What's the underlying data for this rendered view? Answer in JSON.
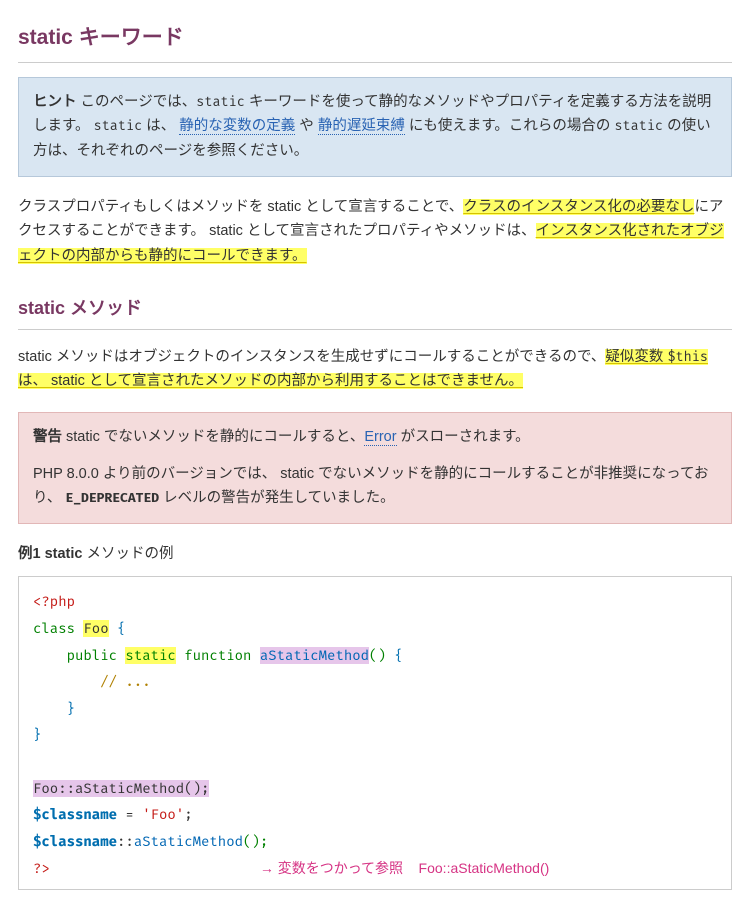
{
  "h2": "static キーワード",
  "tip": {
    "lead": "ヒント",
    "t1": " このページでは、",
    "kw1": "static",
    "t2": " キーワードを使って静的なメソッドやプロパティを定義する方法を説明します。 ",
    "kw2": "static",
    "t3": " は、 ",
    "link1": "静的な変数の定義",
    "t4": " や ",
    "link2": "静的遅延束縛",
    "t5": " にも使えます。これらの場合の ",
    "kw3": "static",
    "t6": " の使い方は、それぞれのページを参照ください。"
  },
  "p1": {
    "t1": "クラスプロパティもしくはメソッドを static として宣言することで、",
    "hl1": "クラスのインスタンス化の必要なし",
    "t2": "にアクセスすることができます。 static として宣言されたプロパティやメソッドは、",
    "hl2": "インスタンス化されたオブジェクトの内部からも静的にコールできます。"
  },
  "h3": "static メソッド",
  "p2": {
    "t1": "static メソッドはオブジェクトのインスタンスを生成せずにコールすることができるので、",
    "hl1": "疑似変数 ",
    "code1": "$this",
    "hl2": " は、 static として宣言されたメソッドの内部から利用することはできません。"
  },
  "warn": {
    "lead": "警告",
    "t1": " static でないメソッドを静的にコールすると、",
    "link": "Error",
    "t2": " がスローされます。",
    "p2a": "PHP 8.0.0 より前のバージョンでは、 static でないメソッドを静的にコールすることが非推奨になっており、 ",
    "const": "E_DEPRECATED",
    "p2b": " レベルの警告が発生していました。"
  },
  "ex": {
    "label": "例1 static",
    "rest": " メソッドの例"
  },
  "code": {
    "open": "<?php",
    "class": "class",
    "Foo": "Foo",
    "lb": "{",
    "public": "public",
    "static": "static",
    "function": "function",
    "method": "aStaticMethod",
    "paren": "()",
    "comment": "// ...",
    "rb": "}",
    "call1": "Foo::aStaticMethod();",
    "var": "$classname",
    "assign": " = ",
    "str": "'Foo'",
    "semi": ";",
    "call2a": "$classname",
    "call2b": "::",
    "call2c": "aStaticMethod",
    "call2d": "();",
    "close": "?>",
    "annot": "→ 変数をつかって参照    Foo::aStaticMethod()"
  }
}
